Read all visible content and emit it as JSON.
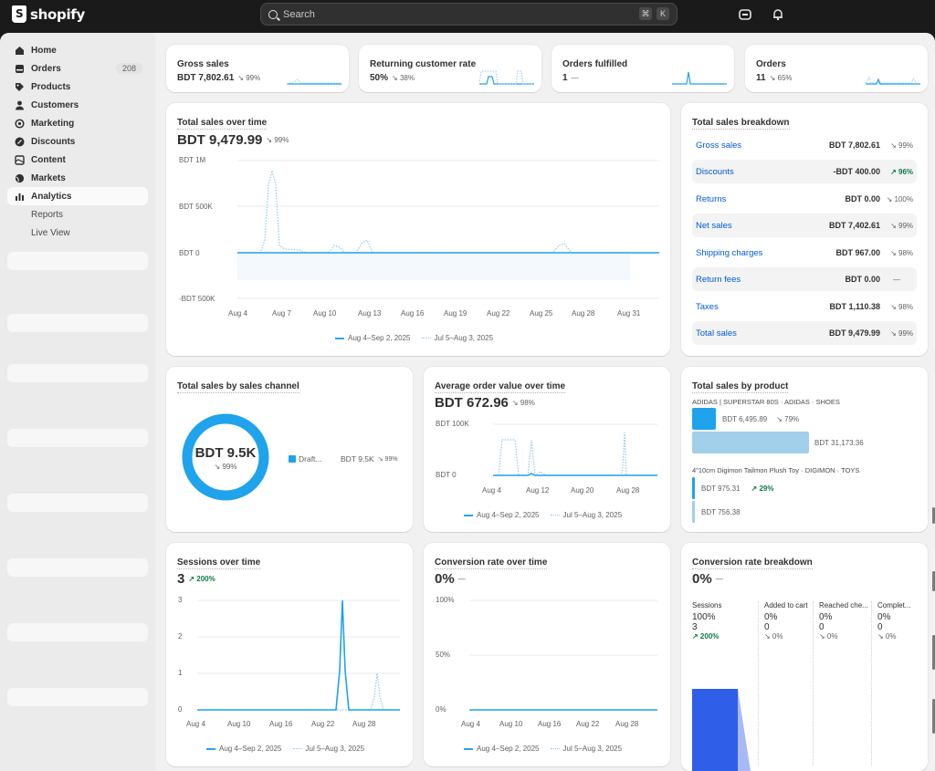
{
  "app": {
    "logo_text": "shopify"
  },
  "search": {
    "placeholder": "Search",
    "kbd1": "⌘",
    "kbd2": "K"
  },
  "sidebar": {
    "items": [
      {
        "label": "Home",
        "icon": "home-icon"
      },
      {
        "label": "Orders",
        "icon": "orders-icon",
        "badge": "208"
      },
      {
        "label": "Products",
        "icon": "tag-icon"
      },
      {
        "label": "Customers",
        "icon": "person-icon"
      },
      {
        "label": "Marketing",
        "icon": "target-icon"
      },
      {
        "label": "Discounts",
        "icon": "discount-icon"
      },
      {
        "label": "Content",
        "icon": "content-icon"
      },
      {
        "label": "Markets",
        "icon": "globe-icon"
      },
      {
        "label": "Analytics",
        "icon": "chart-icon",
        "active": true
      }
    ],
    "sub_items": [
      {
        "label": "Reports"
      },
      {
        "label": "Live View"
      }
    ]
  },
  "kpis": [
    {
      "title": "Gross sales",
      "value": "BDT 7,802.61",
      "delta": "↘ 99%"
    },
    {
      "title": "Returning customer rate",
      "value": "50%",
      "delta": "↘ 38%"
    },
    {
      "title": "Orders fulfilled",
      "value": "1",
      "delta": "—"
    },
    {
      "title": "Orders",
      "value": "11",
      "delta": "↘ 65%"
    }
  ],
  "total_sales": {
    "title": "Total sales over time",
    "value": "BDT 9,479.99",
    "delta": "↘ 99%",
    "y_ticks": [
      "BDT 1M",
      "BDT 500K",
      "BDT 0",
      "-BDT 500K"
    ],
    "x_ticks": [
      "Aug 4",
      "Aug 7",
      "Aug 10",
      "Aug 13",
      "Aug 16",
      "Aug 19",
      "Aug 22",
      "Aug 25",
      "Aug 28",
      "Aug 31"
    ],
    "legend_current": "Aug 4–Sep 2, 2025",
    "legend_previous": "Jul 5–Aug 3, 2025"
  },
  "breakdown": {
    "title": "Total sales breakdown",
    "rows": [
      {
        "label": "Gross sales",
        "value": "BDT 7,802.61",
        "delta": "↘ 99%",
        "up": false
      },
      {
        "label": "Discounts",
        "value": "-BDT 400.00",
        "delta": "↗ 96%",
        "up": true
      },
      {
        "label": "Returns",
        "value": "BDT 0.00",
        "delta": "↘ 100%",
        "up": false
      },
      {
        "label": "Net sales",
        "value": "BDT 7,402.61",
        "delta": "↘ 99%",
        "up": false
      },
      {
        "label": "Shipping charges",
        "value": "BDT 967.00",
        "delta": "↘ 98%",
        "up": false
      },
      {
        "label": "Return fees",
        "value": "BDT 0.00",
        "delta": "—",
        "up": false
      },
      {
        "label": "Taxes",
        "value": "BDT 1,110.38",
        "delta": "↘ 98%",
        "up": false
      },
      {
        "label": "Total sales",
        "value": "BDT 9,479.99",
        "delta": "↘ 99%",
        "up": false
      }
    ]
  },
  "channel": {
    "title": "Total sales by sales channel",
    "donut_value": "BDT 9.5K",
    "donut_delta": "↘ 99%",
    "legend_label": "Draft...",
    "legend_value": "BDT 9.5K",
    "legend_delta": "↘ 99%",
    "color": "#1fa3ec"
  },
  "aov": {
    "title": "Average order value over time",
    "value": "BDT 672.96",
    "delta": "↘ 98%",
    "y_ticks": [
      "BDT 100K",
      "BDT 0"
    ],
    "x_ticks": [
      "Aug 4",
      "Aug 12",
      "Aug 20",
      "Aug 28"
    ],
    "legend_current": "Aug 4–Sep 2, 2025",
    "legend_previous": "Jul 5–Aug 3, 2025"
  },
  "by_product": {
    "title": "Total sales by product",
    "products": [
      {
        "name": "ADIDAS | SUPERSTAR 80S · ADIDAS · SHOES",
        "current": "BDT 6,495.89",
        "delta": "↘ 79%",
        "up": false,
        "previous": "BDT 31,173.36"
      },
      {
        "name": "4\"10cm Digimon Tailmon Plush Toy · DIGIMON · TOYS",
        "current": "BDT 975.31",
        "delta": "↗ 29%",
        "up": true,
        "previous": "BDT 756.38"
      }
    ]
  },
  "sessions": {
    "title": "Sessions over time",
    "value": "3",
    "delta": "↗ 200%",
    "y_ticks": [
      "3",
      "2",
      "1",
      "0"
    ],
    "x_ticks": [
      "Aug 4",
      "Aug 10",
      "Aug 16",
      "Aug 22",
      "Aug 28"
    ],
    "legend_current": "Aug 4–Sep 2, 2025",
    "legend_previous": "Jul 5–Aug 3, 2025"
  },
  "conversion": {
    "title": "Conversion rate over time",
    "value": "0%",
    "delta": "—",
    "y_ticks": [
      "100%",
      "50%",
      "0%"
    ],
    "x_ticks": [
      "Aug 4",
      "Aug 10",
      "Aug 16",
      "Aug 22",
      "Aug 28"
    ],
    "legend_current": "Aug 4–Sep 2, 2025",
    "legend_previous": "Jul 5–Aug 3, 2025"
  },
  "funnel": {
    "title": "Conversion rate breakdown",
    "value": "0%",
    "delta": "—",
    "stages": [
      {
        "label": "Sessions",
        "pct": "100%",
        "count": "3",
        "delta": "↗ 200%",
        "up": true
      },
      {
        "label": "Added to cart",
        "pct": "0%",
        "count": "0",
        "delta": "↘ 0%",
        "up": false
      },
      {
        "label": "Reached che...",
        "pct": "0%",
        "count": "0",
        "delta": "↘ 0%",
        "up": false
      },
      {
        "label": "Complet...",
        "pct": "0%",
        "count": "0",
        "delta": "↘ 0%",
        "up": false
      }
    ]
  },
  "colors": {
    "accent": "#1fa3ec",
    "previous": "#8fc8ec",
    "funnel": "#2f5ee8",
    "positive": "#0c7a43",
    "link": "#005bd3"
  }
}
